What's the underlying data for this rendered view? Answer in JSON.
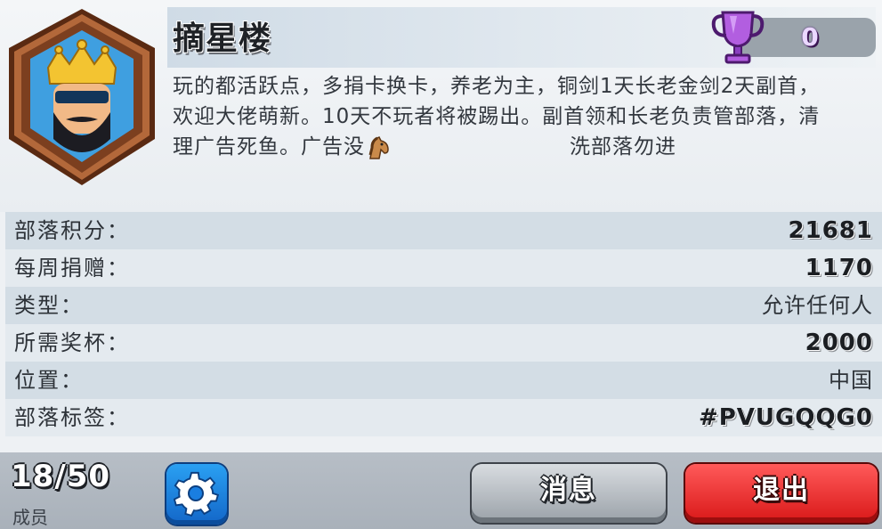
{
  "clan": {
    "name": "摘星楼",
    "trophies": "0",
    "badge_icon": "king-crown-badge-icon",
    "description_lines": [
      "玩的都活跃点，多捐卡换卡，养老为主，铜剑1天长老金剑2天副首，",
      "欢迎大佬萌新。10天不玩者将被踢出。副首领和长老负责管部落，清",
      "理广告死鱼。广告没",
      "洗部落勿进"
    ],
    "description_emoji": "horse-icon"
  },
  "info": {
    "rows": [
      {
        "label": "部落积分：",
        "value": "21681"
      },
      {
        "label": "每周捐赠：",
        "value": "1170"
      },
      {
        "label": "类型：",
        "value": "允许任何人"
      },
      {
        "label": "所需奖杯：",
        "value": "2000"
      },
      {
        "label": "位置：",
        "value": "中国"
      },
      {
        "label": "部落标签：",
        "value": "#PVUGQQG0"
      }
    ]
  },
  "footer": {
    "members_count": "18/50",
    "members_label": "成员",
    "settings_icon": "gear-icon",
    "message_button": "消息",
    "exit_button": "退出"
  },
  "colors": {
    "row_dark": "#d3dde5",
    "row_light": "#e4eaef",
    "settings_blue": "#1a7ee0",
    "exit_red": "#e52424",
    "trophy_purple": "#9b4fd0"
  }
}
